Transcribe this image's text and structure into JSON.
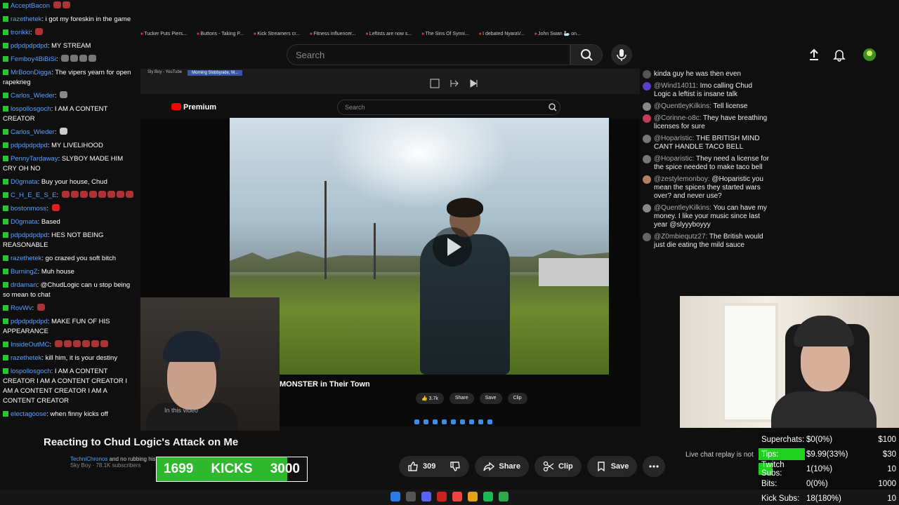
{
  "browser": {
    "bookmarks": [
      "Tucker Puts Piers...",
      "Buttons - Taking P...",
      "Kick Streamers cr...",
      "Fitness influencer...",
      "Leftists are now s...",
      "The Sins Of Synni...",
      "I debated NyaraV...",
      "John Swan 🦢 on..."
    ]
  },
  "youtube": {
    "search_placeholder": "Search",
    "premium_label": "Premium",
    "video_title": "Reacting to Chud Logic's Attack on Me",
    "likes": "309",
    "share_label": "Share",
    "clip_label": "Clip",
    "save_label": "Save",
    "live_chat_replay": "Live chat replay is not",
    "channel_name": "Sky Boy",
    "channel_subs": "78.1K subscribers"
  },
  "inner_video": {
    "tabs": [
      "Sly Boy - YouTube",
      "Morning Slobbyside, M..."
    ],
    "search_placeholder": "Search",
    "premium_label": "Premium",
    "title": "MONSTER in Their Town",
    "likes": "3.7k",
    "share": "Share",
    "save": "Save",
    "clip": "Clip",
    "in_this_video": "In this video"
  },
  "inner_chat": [
    {
      "user": "",
      "text": "kinda guy he was then even",
      "color": "#555"
    },
    {
      "user": "@Wind14011:",
      "text": "Imo calling Chud Logic a leftist is insane talk",
      "color": "#5c3ec9"
    },
    {
      "user": "@QuentleyKilkins:",
      "text": "Tell license",
      "color": "#888"
    },
    {
      "user": "@Corinne-o8c:",
      "text": "They have breathing licenses for sure",
      "color": "#c43c5d"
    },
    {
      "user": "@Hoparistic:",
      "text": "THE BRITISH MIND CANT HANDLE TACO BELL",
      "color": "#777"
    },
    {
      "user": "@Hoparistic:",
      "text": "They need a license for the spice needed to make taco bell",
      "color": "#777"
    },
    {
      "user": "@zestylemonboy:",
      "text": "@Hoparistic you mean the spices they started wars over? and never use?",
      "color": "#b08060"
    },
    {
      "user": "@QuentleyKilkins:",
      "text": "You can have my money. I like your music since last year @slyyyboyyy",
      "color": "#888"
    },
    {
      "user": "@Z0mbiequtz27:",
      "text": "The British would just die eating the mild sauce",
      "color": "#666"
    }
  ],
  "chat": [
    {
      "user": "AcceptBacon",
      "text": "",
      "color": "#5aa0ff"
    },
    {
      "user": "razethetek",
      "text": "i got my foreskin in the game",
      "color": "#5aa0ff"
    },
    {
      "user": "trorikki",
      "text": "",
      "color": "#5aa0ff"
    },
    {
      "user": "pdpdpdpdpd",
      "text": "MY STREAM",
      "color": "#5aa0ff"
    },
    {
      "user": "Femboy4BiBiSi",
      "text": "",
      "color": "#5aa0ff"
    },
    {
      "user": "MrBoonDigga",
      "text": "The vipers yearn for open rapekrieg",
      "color": "#5aa0ff"
    },
    {
      "user": "Carlos_Wieder",
      "text": "",
      "color": "#5aa0ff"
    },
    {
      "user": "lospollosgoch",
      "text": "I AM A CONTENT CREATOR",
      "color": "#5aa0ff"
    },
    {
      "user": "Carlos_Wieder",
      "text": "",
      "color": "#5aa0ff"
    },
    {
      "user": "pdpdpdpdpd",
      "text": "MY LIVELIHOOD",
      "color": "#5aa0ff"
    },
    {
      "user": "PennyTardaway",
      "text": "SLYBOY MADE HIM CRY OH NO",
      "color": "#5aa0ff"
    },
    {
      "user": "D0gmata",
      "text": "Buy your house, Chud",
      "color": "#5aa0ff"
    },
    {
      "user": "C_H_E_E_S_E",
      "text": "",
      "color": "#5aa0ff"
    },
    {
      "user": "bostonmoss",
      "text": "",
      "color": "#5aa0ff"
    },
    {
      "user": "D0gmata",
      "text": "Based",
      "color": "#5aa0ff"
    },
    {
      "user": "pdpdpdpdpd",
      "text": "HES NOT BEING REASONABLE",
      "color": "#5aa0ff"
    },
    {
      "user": "razethetek",
      "text": "go crazed you soft bitch",
      "color": "#5aa0ff"
    },
    {
      "user": "BurningZ",
      "text": "Muh house",
      "color": "#5aa0ff"
    },
    {
      "user": "drdaman",
      "text": "@ChudLogic can u stop being so mean to chat",
      "color": "#5aa0ff"
    },
    {
      "user": "RovWv",
      "text": "",
      "color": "#5aa0ff"
    },
    {
      "user": "pdpdpdpdpd",
      "text": "MAKE FUN OF HIS APPEARANCE",
      "color": "#5aa0ff"
    },
    {
      "user": "InsideOutMC",
      "text": "",
      "color": "#5aa0ff"
    },
    {
      "user": "razethetek",
      "text": "kill him, it is your destiny",
      "color": "#5aa0ff"
    },
    {
      "user": "lospollosgoch",
      "text": "I AM A CONTENT CREATOR I AM A CONTENT CREATOR I AM A CONTENT CREATOR I AM A CONTENT CREATOR",
      "color": "#5aa0ff"
    },
    {
      "user": "electagoose",
      "text": "when finny kicks off",
      "color": "#5aa0ff"
    }
  ],
  "overlay_chat": [
    {
      "user": "TechniChronos",
      "text": "and no rubbing his wealth in our  Join"
    }
  ],
  "kicks": {
    "current": "1699",
    "label": "KICKS",
    "goal": "3000",
    "progress": 0.566
  },
  "goals": [
    {
      "label": "Superchats:",
      "value": "$0(0%)",
      "target": "$100",
      "progress": 0
    },
    {
      "label": "Tips:",
      "value": "$9.99(33%)",
      "target": "$30",
      "progress": 0.33
    },
    {
      "label": "Twitch Subs:",
      "value": "1(10%)",
      "target": "10",
      "progress": 0.1
    },
    {
      "label": "Bits:",
      "value": "0(0%)",
      "target": "1000",
      "progress": 0
    },
    {
      "label": "Kick Subs:",
      "value": "18(180%)",
      "target": "10",
      "progress": 1
    }
  ],
  "colors": {
    "kick_green": "#2db82d",
    "goal_green": "#1fd11f",
    "yt_red": "#ff0000",
    "chat_name": "#5aa0ff"
  }
}
